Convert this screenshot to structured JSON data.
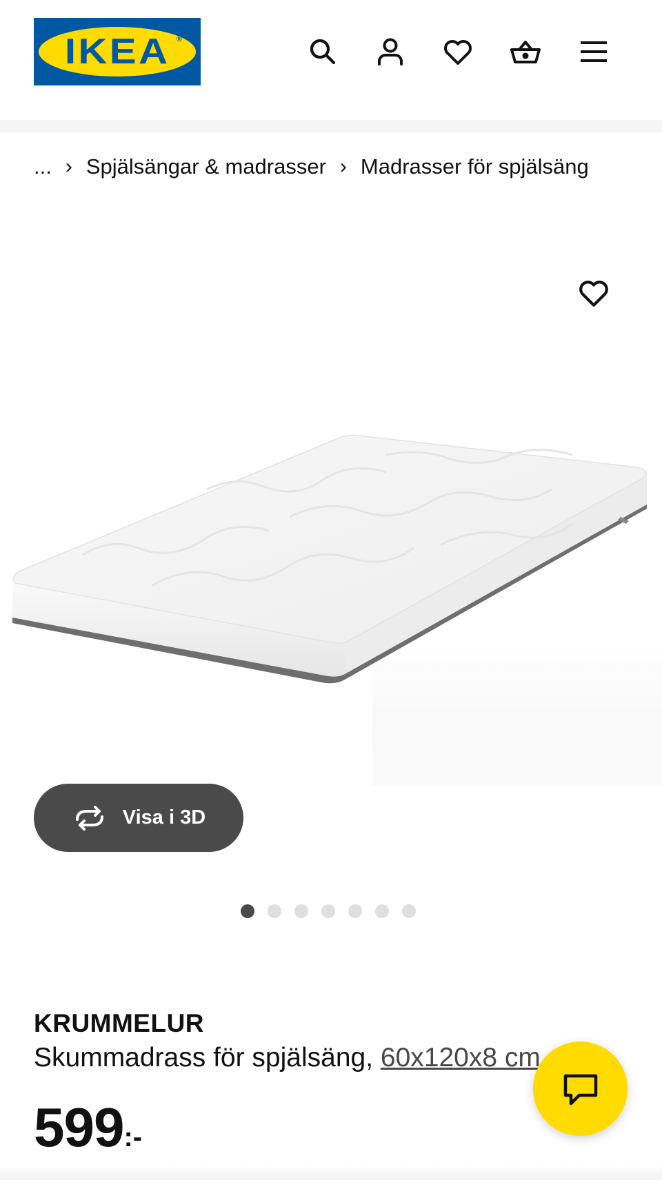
{
  "header": {
    "logo_text": "IKEA",
    "logo_reg": "®",
    "icons": [
      "search-icon",
      "account-icon",
      "favourites-icon",
      "cart-icon",
      "menu-icon"
    ]
  },
  "breadcrumb": {
    "ellipsis": "...",
    "items": [
      "Spjälsängar & madrasser",
      "Madrasser för spjälsäng"
    ]
  },
  "gallery": {
    "view_3d_label": "Visa i 3D",
    "dot_count": 7,
    "active_index": 0
  },
  "product": {
    "name": "KRUMMELUR",
    "description": "Skummadrass för spjälsäng,",
    "size": "60x120x8 cm",
    "price_integer": "599",
    "price_suffix": ":-"
  },
  "colors": {
    "ikea_blue": "#0058a3",
    "ikea_yellow": "#ffdb00",
    "button_dark": "#4a4a4a",
    "dot_inactive": "#dfdfdf"
  }
}
